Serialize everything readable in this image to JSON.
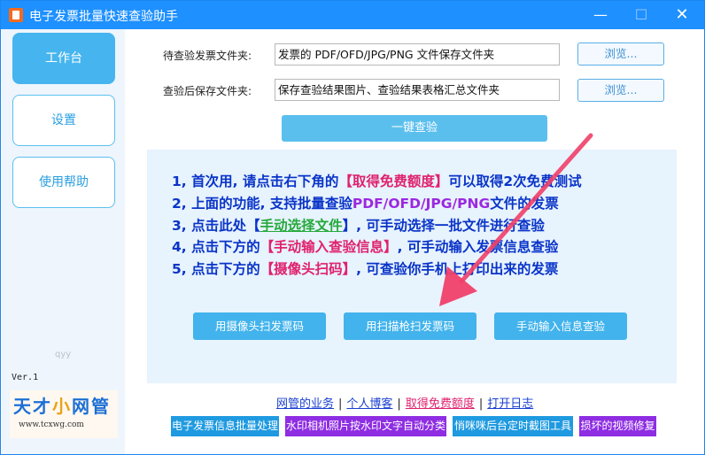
{
  "window": {
    "title": "电子发票批量快速查验助手",
    "controls": {
      "minimize": "—",
      "maximize": "☐",
      "close": "✕"
    }
  },
  "sidebar": {
    "items": [
      {
        "label": "工作台",
        "active": true
      },
      {
        "label": "设置",
        "active": false
      },
      {
        "label": "使用帮助",
        "active": false
      }
    ],
    "watermark": "qyy",
    "version": "Ver.1",
    "logo": {
      "part1": "天才",
      "part2": "小",
      "part3": "网管",
      "url": "www.tcxwg.com"
    }
  },
  "form": {
    "input_label": "待查验发票文件夹:",
    "input_value": "发票的 PDF/OFD/JPG/PNG 文件保存文件夹",
    "output_label": "查验后保存文件夹:",
    "output_value": "保存查验结果图片、查验结果表格汇总文件夹",
    "browse_label": "浏览...",
    "check_button": "一键查验"
  },
  "instructions": {
    "l1": {
      "a": "1, 首次用, 请点击右下角的",
      "b": "【取得免费额度】",
      "c": "可以取得2次免费测试"
    },
    "l2": {
      "a": "2, 上面的功能, 支持批量查验",
      "b": "PDF/OFD/JPG/PNG",
      "c": "文件的发票"
    },
    "l3": {
      "a": "3, 点击此处【",
      "b": "手动选择文件",
      "c": "】, 可手动选择一批文件进行查验"
    },
    "l4": {
      "a": "4, 点击下方的",
      "b": "【手动输入查验信息】",
      "c": ", 可手动输入发票信息查验"
    },
    "l5": {
      "a": "5, 点击下方的",
      "b": "【摄像头扫码】",
      "c": ", 可查验你手机上打印出来的发票"
    }
  },
  "actions": {
    "camera": "用摄像头扫发票码",
    "scanner": "用扫描枪扫发票码",
    "manual": "手动输入信息查验"
  },
  "footer_links": {
    "service": "网管的业务",
    "blog": "个人博客",
    "free_quota": "取得免费额度",
    "log": "打开日志",
    "separator": "|"
  },
  "promos": {
    "p1": "电子发票信息批量处理",
    "p2": "水印相机照片按水印文字自动分类",
    "p3": "悄咪咪后台定时截图工具",
    "p4": "损坏的视频修复"
  },
  "colors": {
    "titlebar": "#1e90ff",
    "accent": "#42b3ec",
    "instruction_text": "#0a34c8",
    "highlight_red": "#e0226e",
    "highlight_purple": "#9b28e0",
    "highlight_green": "#26a93c",
    "arrow": "#f0406a"
  }
}
